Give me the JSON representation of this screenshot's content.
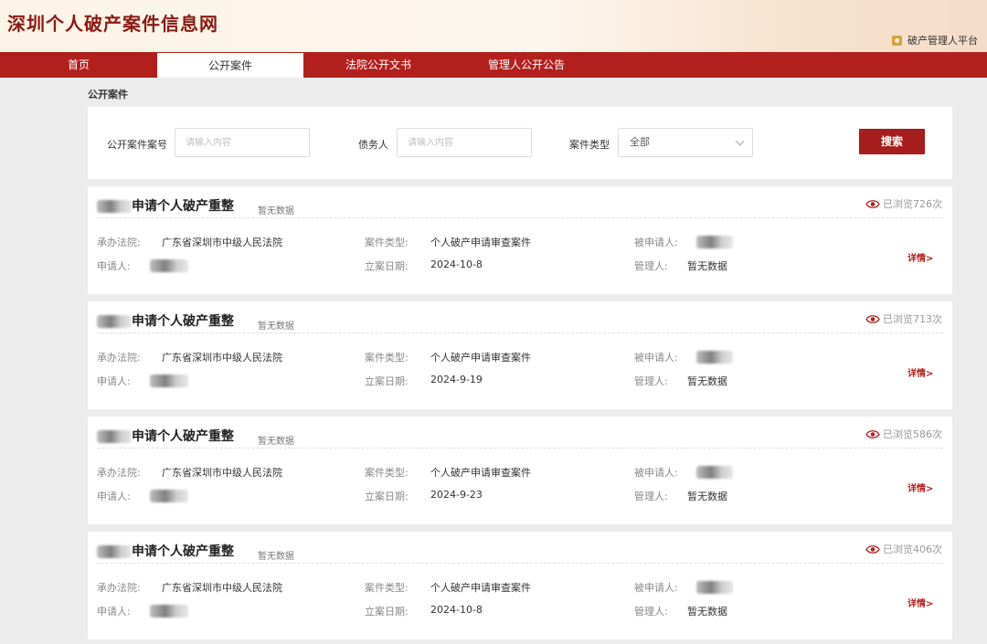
{
  "header": {
    "site_title": "深圳个人破产案件信息网",
    "platform_link": "破产管理人平台"
  },
  "nav": {
    "tabs": [
      {
        "label": "首页",
        "active": false
      },
      {
        "label": "公开案件",
        "active": true
      },
      {
        "label": "法院公开文书",
        "active": false
      },
      {
        "label": "管理人公开公告",
        "active": false
      }
    ]
  },
  "section_title": "公开案件",
  "search": {
    "case_no_label": "公开案件案号",
    "case_no_placeholder": "请输入内容",
    "debtor_label": "债务人",
    "debtor_placeholder": "请输入内容",
    "type_label": "案件类型",
    "type_value": "全部",
    "button": "搜索"
  },
  "labels": {
    "court": "承办法院:",
    "case_type": "案件类型:",
    "respondent": "被申请人:",
    "applicant": "申请人:",
    "filing_date": "立案日期:",
    "manager": "管理人:",
    "detail": "详情>"
  },
  "colors": {
    "brand_red": "#b2201e",
    "title_red": "#8b1a14"
  },
  "cases": [
    {
      "title": "申请个人破产重整",
      "note": "暂无数据",
      "views": "已浏览726次",
      "court": "广东省深圳市中级人民法院",
      "case_type": "个人破产申请审查案件",
      "filing_date": "2024-10-8",
      "manager": "暂无数据"
    },
    {
      "title": "申请个人破产重整",
      "note": "暂无数据",
      "views": "已浏览713次",
      "court": "广东省深圳市中级人民法院",
      "case_type": "个人破产申请审查案件",
      "filing_date": "2024-9-19",
      "manager": "暂无数据"
    },
    {
      "title": "申请个人破产重整",
      "note": "暂无数据",
      "views": "已浏览586次",
      "court": "广东省深圳市中级人民法院",
      "case_type": "个人破产申请审查案件",
      "filing_date": "2024-9-23",
      "manager": "暂无数据"
    },
    {
      "title": "申请个人破产重整",
      "note": "暂无数据",
      "views": "已浏览406次",
      "court": "广东省深圳市中级人民法院",
      "case_type": "个人破产申请审查案件",
      "filing_date": "2024-10-8",
      "manager": "暂无数据"
    }
  ]
}
